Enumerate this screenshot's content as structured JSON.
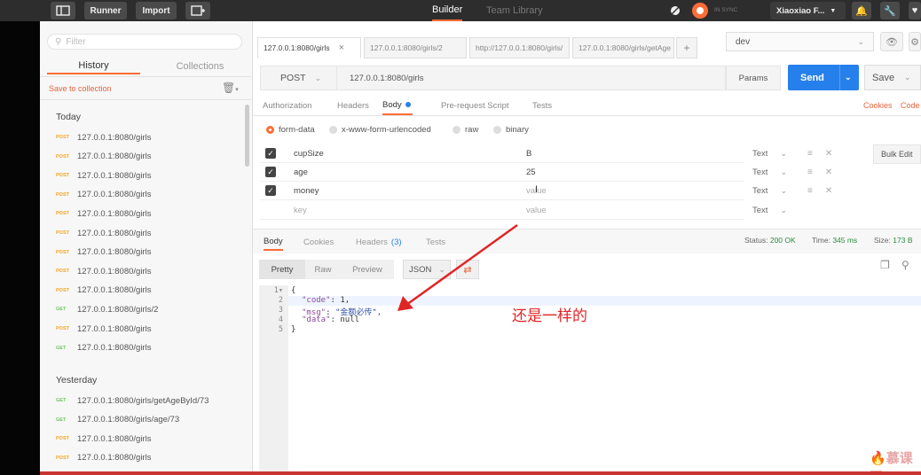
{
  "topbar": {
    "runner": "Runner",
    "import": "Import",
    "builder": "Builder",
    "team_library": "Team Library",
    "sync": "IN SYNC",
    "user": "Xiaoxiao F..."
  },
  "sidebar": {
    "filter_placeholder": "Filter",
    "tab_history": "History",
    "tab_collections": "Collections",
    "save_to_collection": "Save to collection",
    "group_today": "Today",
    "group_yesterday": "Yesterday",
    "today_items": [
      {
        "method": "POST",
        "url": "127.0.0.1:8080/girls"
      },
      {
        "method": "POST",
        "url": "127.0.0.1:8080/girls"
      },
      {
        "method": "POST",
        "url": "127.0.0.1:8080/girls"
      },
      {
        "method": "POST",
        "url": "127.0.0.1:8080/girls"
      },
      {
        "method": "POST",
        "url": "127.0.0.1:8080/girls"
      },
      {
        "method": "POST",
        "url": "127.0.0.1:8080/girls"
      },
      {
        "method": "POST",
        "url": "127.0.0.1:8080/girls"
      },
      {
        "method": "POST",
        "url": "127.0.0.1:8080/girls"
      },
      {
        "method": "POST",
        "url": "127.0.0.1:8080/girls"
      },
      {
        "method": "GET",
        "url": "127.0.0.1:8080/girls/2"
      },
      {
        "method": "POST",
        "url": "127.0.0.1:8080/girls"
      },
      {
        "method": "GET",
        "url": "127.0.0.1:8080/girls"
      }
    ],
    "yesterday_items": [
      {
        "method": "GET",
        "url": "127.0.0.1:8080/girls/getAgeById/73"
      },
      {
        "method": "GET",
        "url": "127.0.0.1:8080/girls/age/73"
      },
      {
        "method": "POST",
        "url": "127.0.0.1:8080/girls"
      },
      {
        "method": "POST",
        "url": "127.0.0.1:8080/girls"
      }
    ]
  },
  "request_tabs": [
    {
      "label": "127.0.0.1:8080/girls",
      "close": "×"
    },
    {
      "label": "127.0.0.1:8080/girls/2"
    },
    {
      "label": "http://127.0.0.1:8080/girls/"
    },
    {
      "label": "127.0.0.1:8080/girls/getAge"
    }
  ],
  "new_tab": "+",
  "environment": "dev",
  "request": {
    "method": "POST",
    "url": "127.0.0.1:8080/girls",
    "params": "Params",
    "send": "Send",
    "save": "Save"
  },
  "subtabs": {
    "authorization": "Authorization",
    "headers": "Headers",
    "body": "Body",
    "prerequest": "Pre-request Script",
    "tests": "Tests",
    "cookies": "Cookies",
    "code": "Code"
  },
  "body_modes": {
    "form_data": "form-data",
    "urlencoded": "x-www-form-urlencoded",
    "raw": "raw",
    "binary": "binary"
  },
  "form_rows": [
    {
      "key": "cupSize",
      "value": "B",
      "type": "Text"
    },
    {
      "key": "age",
      "value": "25",
      "type": "Text"
    },
    {
      "key": "money",
      "value": "value",
      "type": "Text"
    }
  ],
  "new_row": {
    "key": "key",
    "value": "value",
    "type": "Text"
  },
  "bulk_edit": "Bulk Edit",
  "response": {
    "tab_body": "Body",
    "tab_cookies": "Cookies",
    "tab_headers": "Headers",
    "headers_count": "(3)",
    "tab_tests": "Tests",
    "status_label": "Status:",
    "status_value": "200 OK",
    "time_label": "Time:",
    "time_value": "345 ms",
    "size_label": "Size:",
    "size_value": "173 B",
    "pretty": "Pretty",
    "raw": "Raw",
    "preview": "Preview",
    "format": "JSON"
  },
  "code_lines": [
    {
      "n": "1",
      "text": "{"
    },
    {
      "n": "2",
      "key": "\"code\"",
      "sep": ": ",
      "val": "1,"
    },
    {
      "n": "3",
      "key": "\"msg\"",
      "sep": ": ",
      "val": "\"金额必传\","
    },
    {
      "n": "4",
      "key": "\"data\"",
      "sep": ": ",
      "val": "null"
    },
    {
      "n": "5",
      "text": "}"
    }
  ],
  "annotation": "还是一样的",
  "watermark": "慕课网"
}
